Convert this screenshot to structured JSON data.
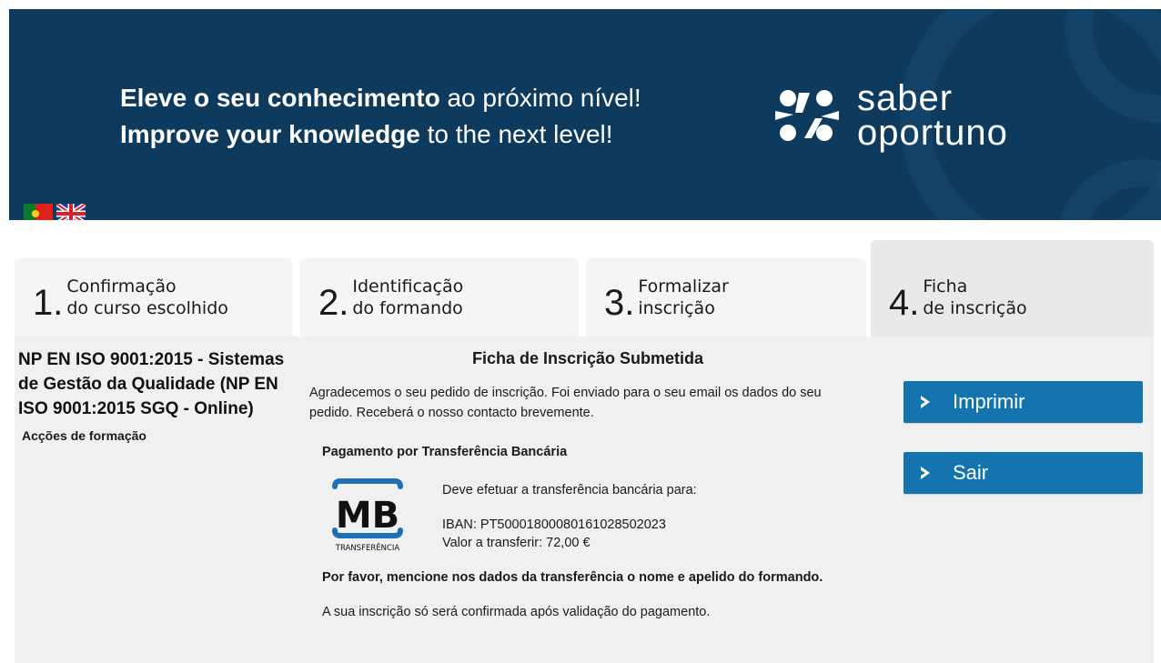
{
  "banner": {
    "line1_bold": "Eleve o seu conhecimento",
    "line1_rest": " ao próximo nível!",
    "line2_bold": "Improve your knowledge",
    "line2_rest": " to the next level!",
    "logo_line1": "saber",
    "logo_line2": "oportuno",
    "logo_icon": "saber-oportuno-logo-icon",
    "flags": [
      "portugal-flag-icon",
      "uk-flag-icon"
    ],
    "bg_color": "#0e3a5e"
  },
  "steps": [
    {
      "num": "1.",
      "line1": "Confirmação",
      "line2": "do curso escolhido",
      "active": false
    },
    {
      "num": "2.",
      "line1": "Identificação",
      "line2": "do formando",
      "active": false
    },
    {
      "num": "3.",
      "line1": "Formalizar",
      "line2": "inscrição",
      "active": false
    },
    {
      "num": "4.",
      "line1": "Ficha",
      "line2": "de inscrição",
      "active": true
    }
  ],
  "course": {
    "title": "NP EN ISO 9001:2015 - Sistemas de Gestão da Qualidade (NP EN ISO 9001:2015 SGQ - Online)",
    "subtitle": "Acções de formação"
  },
  "main": {
    "title": "Ficha de Inscrição Submetida",
    "thanks": "Agradecemos o seu pedido de inscrição. Foi enviado para o seu email os dados do seu pedido. Receberá o nosso contacto brevemente.",
    "payment_title": "Pagamento por Transferência Bancária",
    "mb_logo_text": "MB",
    "mb_logo_sub": "TRANSFERÊNCIA",
    "transfer_intro": "Deve efetuar a transferência bancária para:",
    "iban": "IBAN: PT50001800080161028502023",
    "amount": "Valor a transferir: 72,00 €",
    "notice_bold": "Por favor, mencione nos dados da transferência o nome e apelido do formando.",
    "notice": "A sua inscrição só será confirmada após validação do pagamento."
  },
  "actions": {
    "print_label": "Imprimir",
    "exit_label": "Sair",
    "icon": "chevron-right-icon",
    "color": "#1573ae"
  }
}
